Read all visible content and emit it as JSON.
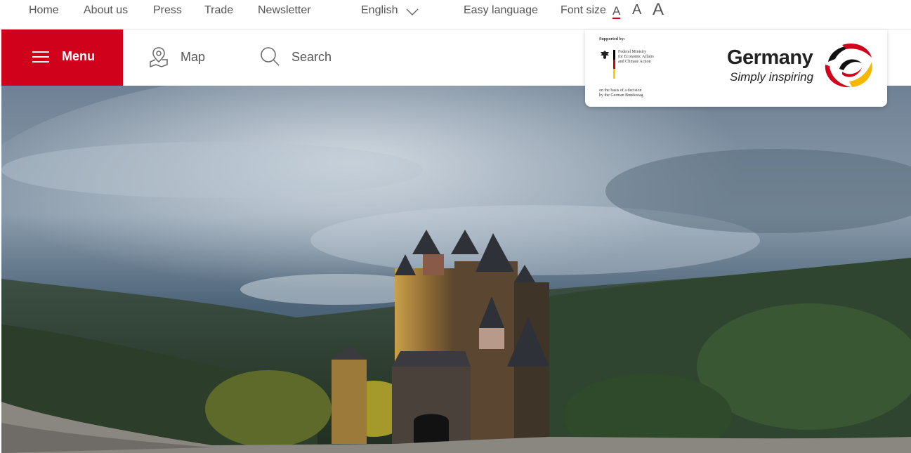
{
  "top_nav": {
    "home": "Home",
    "about": "About us",
    "press": "Press",
    "trade": "Trade",
    "newsletter": "Newsletter",
    "language": "English",
    "easy_language": "Easy language",
    "font_size_label": "Font size",
    "font_size_options": [
      "A",
      "A",
      "A"
    ]
  },
  "main_nav": {
    "menu": "Menu",
    "map": "Map",
    "search": "Search"
  },
  "logo": {
    "supported_by": "Supported by:",
    "ministry": "Federal Ministry\nfor Economic Affairs\nand Climate Action",
    "basis": "on the basis of a decision\nby the German Bundestag",
    "brand_name": "Germany",
    "brand_tagline": "Simply inspiring"
  },
  "hero": {
    "image": "castle-in-forest-under-cloudy-sky"
  },
  "colors": {
    "accent_red": "#d0021b",
    "text_gray": "#555555",
    "flag_black": "#000000",
    "flag_red": "#dd0000",
    "flag_gold": "#ffcc00"
  }
}
